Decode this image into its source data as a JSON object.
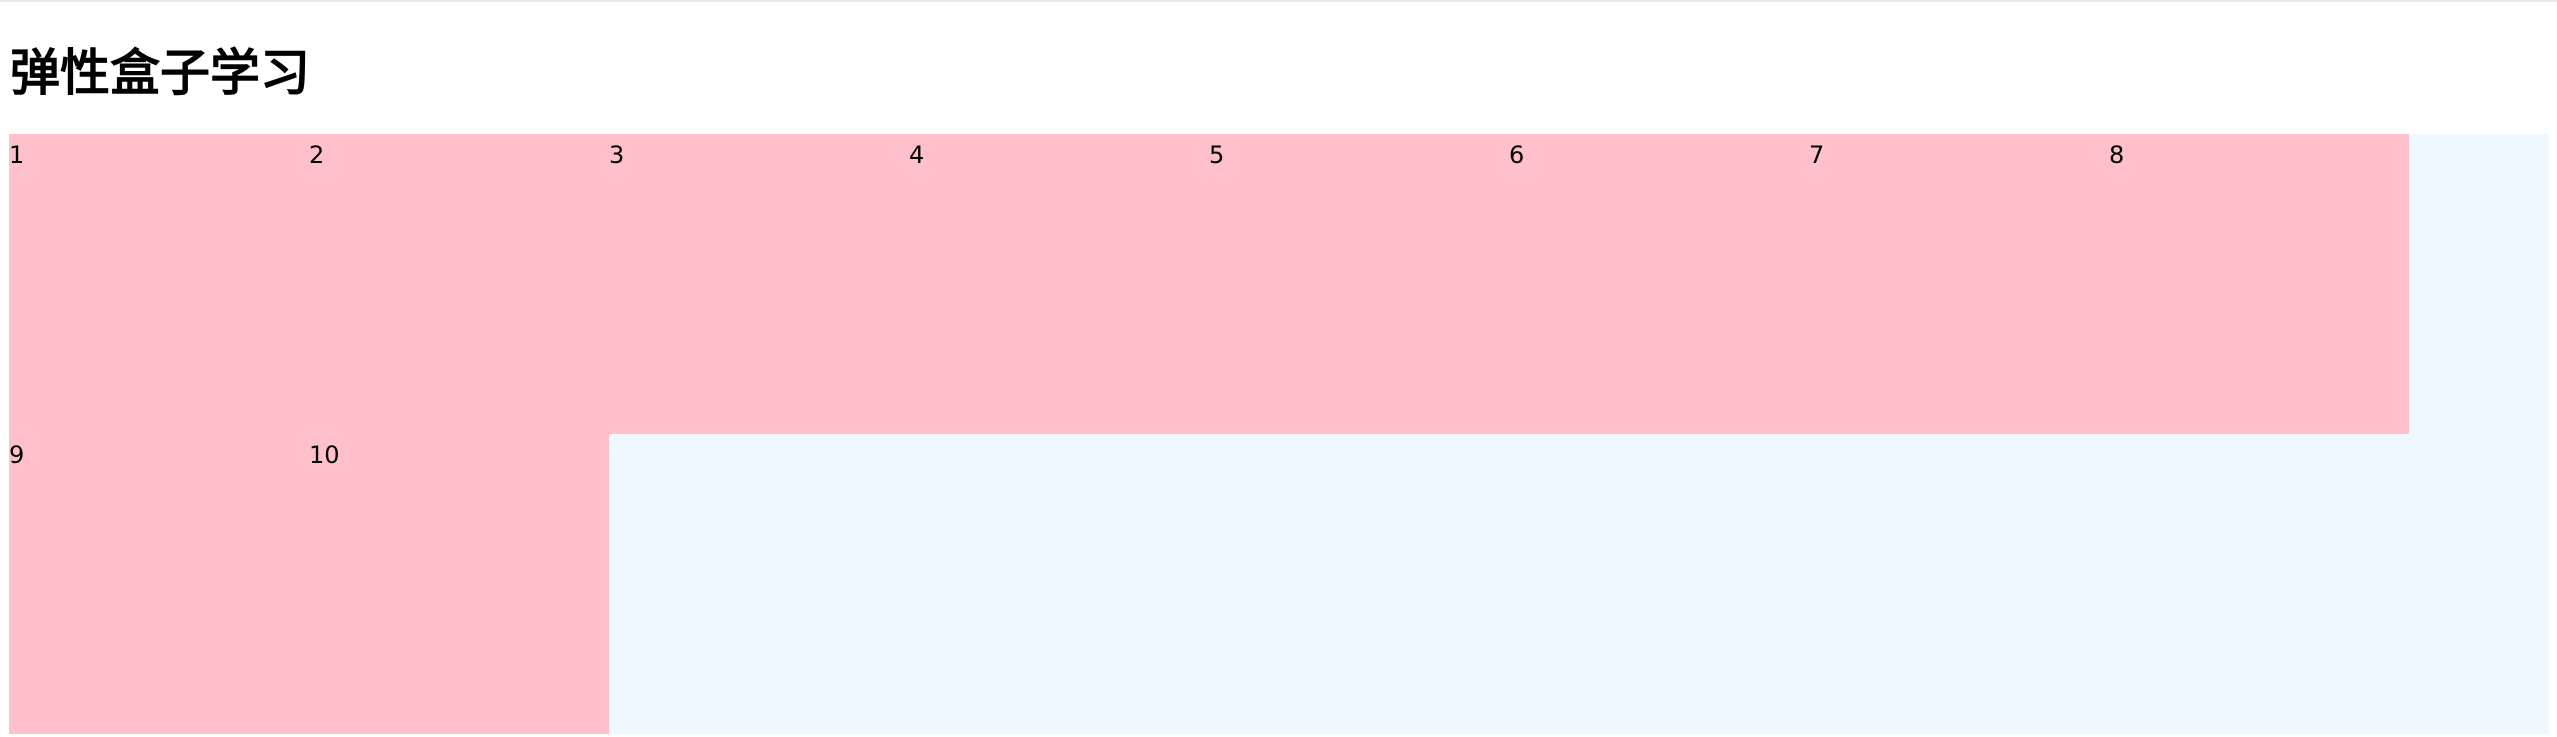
{
  "page": {
    "title": "弹性盒子学习"
  },
  "container": {
    "background": "#eff7ff",
    "item_color": "#ffc0cb",
    "items": [
      "1",
      "2",
      "3",
      "4",
      "5",
      "6",
      "7",
      "8",
      "9",
      "10"
    ]
  }
}
